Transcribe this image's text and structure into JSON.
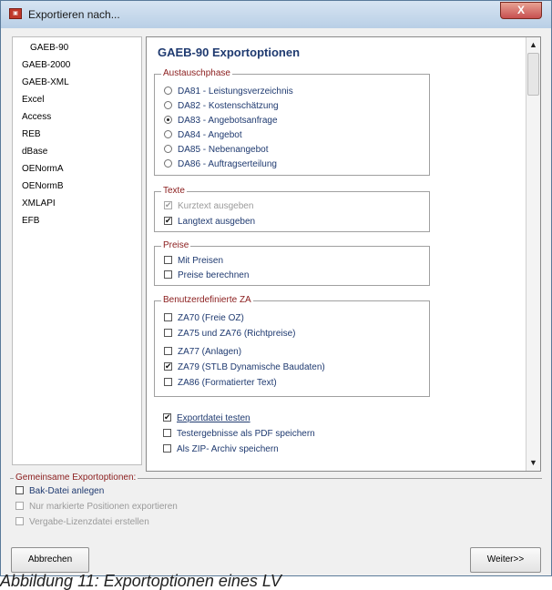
{
  "window": {
    "title": "Exportieren nach...",
    "close_glyph": "X",
    "app_icon": "app-icon"
  },
  "formats": [
    "GAEB-90",
    "GAEB-2000",
    "GAEB-XML",
    "Excel",
    "Access",
    "REB",
    "dBase",
    "OENormA",
    "OENormB",
    "XMLAPI",
    "EFB"
  ],
  "selected_format": "GAEB-90",
  "panel": {
    "title": "GAEB-90 Exportoptionen",
    "austauschphase": {
      "legend": "Austauschphase",
      "options": [
        {
          "label": "DA81 - Leistungsverzeichnis",
          "selected": false
        },
        {
          "label": "DA82 - Kostenschätzung",
          "selected": false
        },
        {
          "label": "DA83 - Angebotsanfrage",
          "selected": true
        },
        {
          "label": "DA84 - Angebot",
          "selected": false
        },
        {
          "label": "DA85 - Nebenangebot",
          "selected": false
        },
        {
          "label": "DA86 - Auftragserteilung",
          "selected": false
        }
      ]
    },
    "texte": {
      "legend": "Texte",
      "kurztext": {
        "label": "Kurztext ausgeben",
        "checked": true,
        "disabled": true
      },
      "langtext": {
        "label": "Langtext ausgeben",
        "checked": true,
        "disabled": false
      }
    },
    "preise": {
      "legend": "Preise",
      "mit_preisen": {
        "label": "Mit Preisen",
        "checked": false
      },
      "preise_berechnen": {
        "label": "Preise berechnen",
        "checked": false
      }
    },
    "benutzerdefinierte": {
      "legend": "Benutzerdefinierte ZA",
      "za70": {
        "label": "ZA70 (Freie OZ)",
        "checked": false
      },
      "za75": {
        "label": "ZA75 und ZA76 (Richtpreise)",
        "checked": false
      },
      "za77": {
        "label": "ZA77 (Anlagen)",
        "checked": false
      },
      "za79": {
        "label": "ZA79 (STLB Dynamische Baudaten)",
        "checked": true
      },
      "za86": {
        "label": "ZA86 (Formatierter Text)",
        "checked": false
      }
    },
    "test": {
      "exportdatei_testen": {
        "label": "Exportdatei testen",
        "checked": true
      },
      "pdf": {
        "label": "Testergebnisse als PDF speichern",
        "checked": false
      },
      "zip": {
        "label": "Als ZIP- Archiv speichern",
        "checked": false
      }
    },
    "scroll_position": 0.0
  },
  "common": {
    "legend": "Gemeinsame Exportoptionen:",
    "bak": {
      "label": "Bak-Datei anlegen",
      "checked": false
    },
    "markiert": {
      "label": "Nur markierte Positionen exportieren",
      "checked": false,
      "disabled": true
    },
    "vergabe": {
      "label": "Vergabe-Lizenzdatei erstellen",
      "checked": false,
      "disabled": true
    }
  },
  "buttons": {
    "cancel": "Abbrechen",
    "next": "Weiter>>"
  },
  "check_glyph": "✔",
  "scroll_up_glyph": "▲",
  "scroll_down_glyph": "▼",
  "caption": "Abbildung 11: Exportoptionen eines LV"
}
